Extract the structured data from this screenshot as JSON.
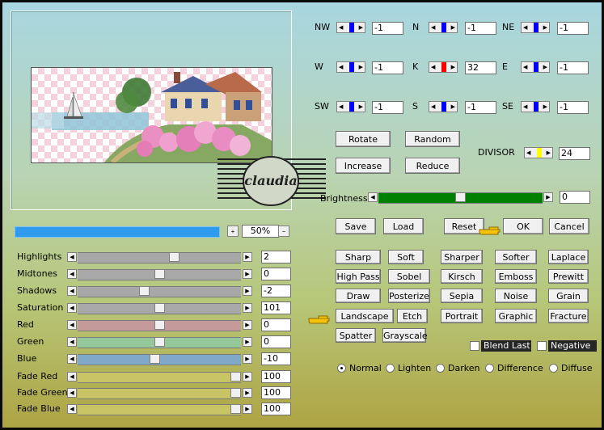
{
  "matrix": {
    "rows": [
      [
        {
          "label": "NW",
          "value": "-1",
          "color": "#0000ff"
        },
        {
          "label": "N",
          "value": "-1",
          "color": "#0000ff"
        },
        {
          "label": "NE",
          "value": "-1",
          "color": "#0000ff"
        }
      ],
      [
        {
          "label": "W",
          "value": "-1",
          "color": "#0000ff"
        },
        {
          "label": "K",
          "value": "32",
          "color": "#ff0000"
        },
        {
          "label": "E",
          "value": "-1",
          "color": "#0000ff"
        }
      ],
      [
        {
          "label": "SW",
          "value": "-1",
          "color": "#0000ff"
        },
        {
          "label": "S",
          "value": "-1",
          "color": "#0000ff"
        },
        {
          "label": "SE",
          "value": "-1",
          "color": "#0000ff"
        }
      ]
    ]
  },
  "top_buttons": {
    "rotate": "Rotate",
    "random": "Random",
    "increase": "Increase",
    "reduce": "Reduce"
  },
  "divisor": {
    "label": "DIVISOR",
    "value": "24",
    "color": "#ffff00"
  },
  "brightness": {
    "label": "Brightness",
    "value": "0",
    "level": 0.5
  },
  "action_buttons": {
    "save": "Save",
    "load": "Load",
    "reset": "Reset",
    "ok": "OK",
    "cancel": "Cancel"
  },
  "zoom": {
    "value": "50%",
    "plus": "+",
    "minus": "−"
  },
  "watermark": {
    "text": "claudia"
  },
  "sliders": [
    {
      "label": "Highlights",
      "value": "2",
      "color": "#a8a8a8",
      "level": 0.6
    },
    {
      "label": "Midtones",
      "value": "0",
      "color": "#a8a8a8",
      "level": 0.5
    },
    {
      "label": "Shadows",
      "value": "-2",
      "color": "#a8a8a8",
      "level": 0.4
    },
    {
      "label": "Saturation",
      "value": "101",
      "color": "#a8a8a8",
      "level": 0.5
    },
    {
      "label": "Red",
      "value": "0",
      "color": "#c49a9a",
      "level": 0.5
    },
    {
      "label": "Green",
      "value": "0",
      "color": "#94c79a",
      "level": 0.5
    },
    {
      "label": "Blue",
      "value": "-10",
      "color": "#7fa8c9",
      "level": 0.47
    },
    {
      "label": "Fade Red",
      "value": "100",
      "color": "#c8c365",
      "level": 1.0
    },
    {
      "label": "Fade Green",
      "value": "100",
      "color": "#c8c365",
      "level": 1.0
    },
    {
      "label": "Fade Blue",
      "value": "100",
      "color": "#c8c365",
      "level": 1.0
    }
  ],
  "presets": [
    [
      "Sharp",
      "Soft",
      "Sharper",
      "Softer",
      "Laplace"
    ],
    [
      "High Pass",
      "Sobel",
      "Kirsch",
      "Emboss",
      "Prewitt"
    ],
    [
      "Draw",
      "Posterize",
      "Sepia",
      "Noise",
      "Grain"
    ],
    [
      "Landscape",
      "Etch",
      "Portrait",
      "Graphic",
      "Fracture"
    ],
    [
      "Spatter",
      "Grayscale"
    ]
  ],
  "checkboxes": {
    "blend_last": "Blend Last",
    "negative": "Negative"
  },
  "blend_modes": [
    "Normal",
    "Lighten",
    "Darken",
    "Difference",
    "Diffuse"
  ],
  "selected_mode": "Normal",
  "colors": {
    "brightness_track": "#008000",
    "zoom_bar": "#2f9bef",
    "pointer_hand": "#f4c20d"
  }
}
